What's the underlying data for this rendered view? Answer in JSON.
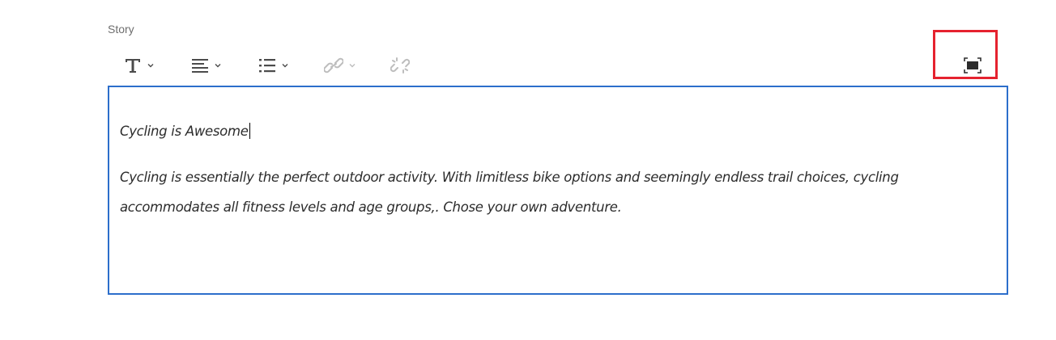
{
  "field": {
    "label": "Story"
  },
  "toolbar": {
    "tools": [
      {
        "name": "text-format",
        "icon": "text-format-icon",
        "has_dropdown": true,
        "enabled": true
      },
      {
        "name": "justify",
        "icon": "align-left-icon",
        "has_dropdown": true,
        "enabled": true
      },
      {
        "name": "list",
        "icon": "bulleted-list-icon",
        "has_dropdown": true,
        "enabled": true
      },
      {
        "name": "link",
        "icon": "link-icon",
        "has_dropdown": true,
        "enabled": false
      },
      {
        "name": "unlink",
        "icon": "unlink-icon",
        "has_dropdown": false,
        "enabled": false
      }
    ],
    "fullscreen": {
      "icon": "fullscreen-icon"
    }
  },
  "editor": {
    "heading": "Cycling is Awesome",
    "body": "Cycling is essentially the perfect outdoor activity. With limitless bike options and seemingly endless trail choices, cycling accommodates all fitness levels and age groups,. Chose your own adventure."
  },
  "colors": {
    "accent": "#2c6ecb",
    "highlight": "#e5222f",
    "icon": "#4b4b4b",
    "icon_disabled": "#bdbdbd"
  }
}
